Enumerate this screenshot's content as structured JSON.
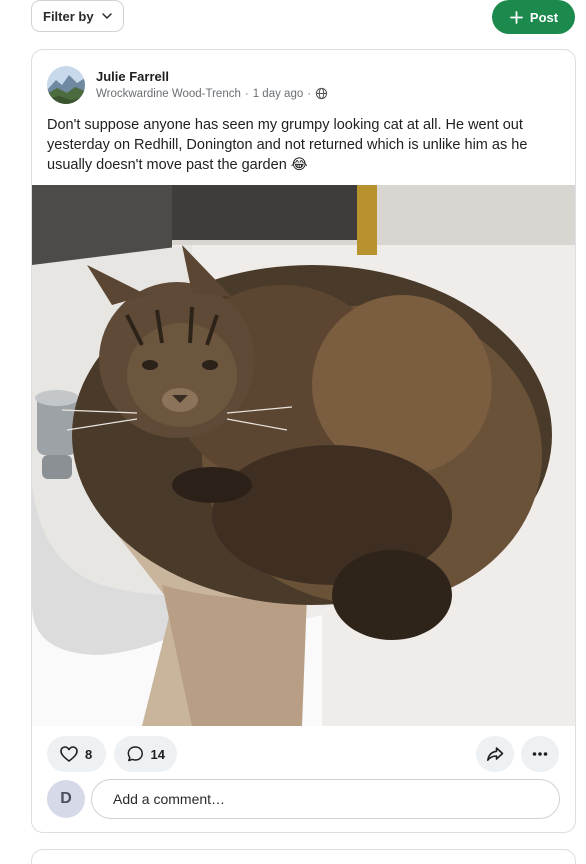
{
  "toolbar": {
    "filter_label": "Filter by",
    "post_label": "Post"
  },
  "post": {
    "author": "Julie Farrell",
    "location": "Wrockwardine Wood-Trench",
    "time": "1 day ago",
    "separator": "·",
    "visibility_icon": "globe-icon",
    "body": "Don't suppose anyone has seen my grumpy looking cat at all. He went out yesterday on Redhill, Donington and not returned which is unlike him as he usually doesn't move past the garden 😂",
    "photo_icon": "cat-photo",
    "likes": "8",
    "comments": "14"
  },
  "comment_box": {
    "avatar_initial": "D",
    "placeholder": "Add a comment…"
  },
  "colors": {
    "accent": "#1c8a4c",
    "border": "#dcdfe2",
    "chip": "#eef1f3",
    "avatar_bg": "#d5d9e8"
  }
}
